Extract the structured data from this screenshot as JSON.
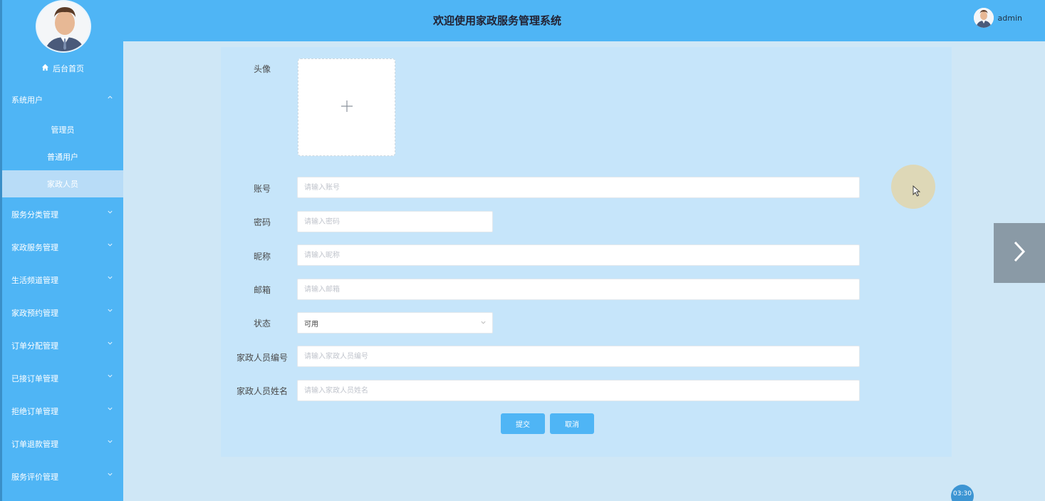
{
  "header": {
    "title": "欢迎使用家政服务管理系统",
    "username": "admin"
  },
  "sidebar": {
    "home_label": "后台首页",
    "group_open": {
      "label": "系统用户",
      "chevron": "chevron-up-icon"
    },
    "sub_items": [
      {
        "label": "管理员"
      },
      {
        "label": "普通用户"
      },
      {
        "label": "家政人员",
        "active": true
      }
    ],
    "groups": [
      {
        "label": "服务分类管理"
      },
      {
        "label": "家政服务管理"
      },
      {
        "label": "生活频道管理"
      },
      {
        "label": "家政预约管理"
      },
      {
        "label": "订单分配管理"
      },
      {
        "label": "已接订单管理"
      },
      {
        "label": "拒绝订单管理"
      },
      {
        "label": "订单退款管理"
      },
      {
        "label": "服务评价管理"
      }
    ]
  },
  "form": {
    "avatar_label": "头像",
    "account_label": "账号",
    "account_placeholder": "请输入账号",
    "password_label": "密码",
    "password_placeholder": "请输入密码",
    "nickname_label": "昵称",
    "nickname_placeholder": "请输入昵称",
    "email_label": "邮箱",
    "email_placeholder": "请输入邮箱",
    "status_label": "状态",
    "status_value": "可用",
    "staff_no_label": "家政人员编号",
    "staff_no_placeholder": "请输入家政人员编号",
    "staff_name_label": "家政人员姓名",
    "staff_name_placeholder": "请输入家政人员姓名",
    "submit_label": "提交",
    "cancel_label": "取消"
  },
  "overlay": {
    "timer": "03:30"
  },
  "colors": {
    "primary": "#4fb5f5",
    "background": "#cfe7f6"
  }
}
